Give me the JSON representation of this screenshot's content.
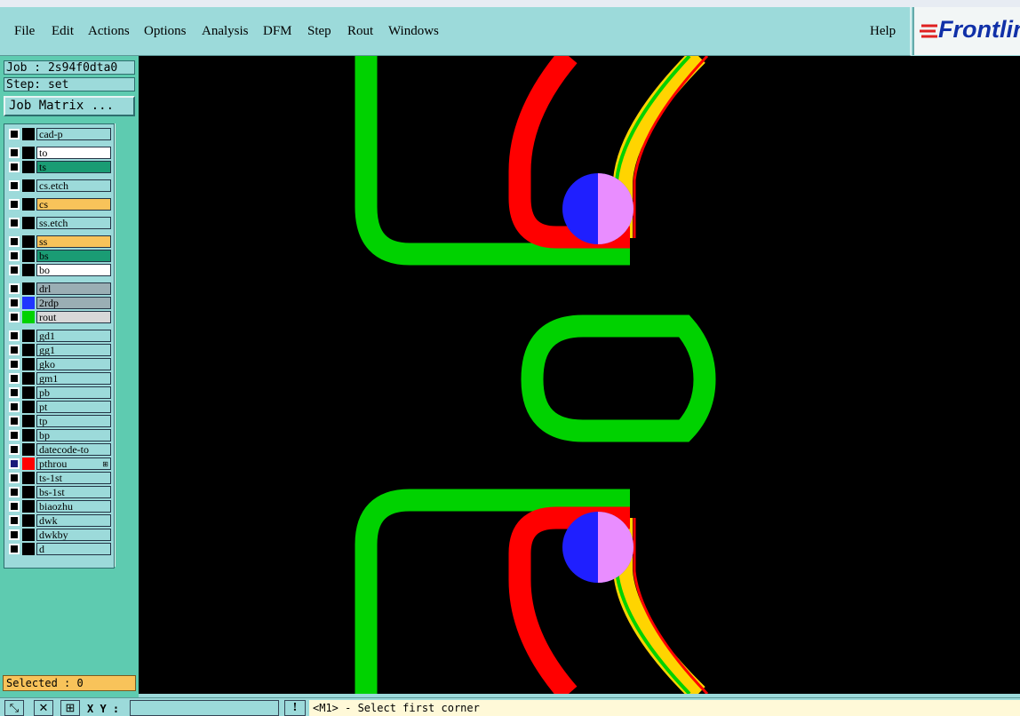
{
  "menu": {
    "items": [
      "File",
      "Edit",
      "Actions",
      "Options",
      "Analysis",
      "DFM",
      "Step",
      "Rout",
      "Windows"
    ],
    "help": "Help"
  },
  "logo": {
    "text": "Frontline"
  },
  "job": {
    "label": "Job : 2s94f0dta0",
    "step": "Step: set"
  },
  "job_matrix_label": "Job Matrix ...",
  "layers": [
    {
      "name": "cad-p",
      "name_bg": "#9cdada",
      "swatch": "#000000",
      "checked": false
    },
    {
      "name": "to",
      "name_bg": "#ffffff",
      "swatch": "#000000",
      "checked": false
    },
    {
      "name": "ts",
      "name_bg": "#1a9c74",
      "swatch": "#000000",
      "checked": false
    },
    {
      "name": "cs.etch",
      "name_bg": "#9cdada",
      "swatch": "#000000",
      "checked": false
    },
    {
      "name": "cs",
      "name_bg": "#f8c35a",
      "swatch": "#000000",
      "checked": false
    },
    {
      "name": "ss.etch",
      "name_bg": "#9cdada",
      "swatch": "#000000",
      "checked": false
    },
    {
      "name": "ss",
      "name_bg": "#f8c35a",
      "swatch": "#000000",
      "checked": false
    },
    {
      "name": "bs",
      "name_bg": "#1a9c74",
      "swatch": "#000000",
      "checked": false
    },
    {
      "name": "bo",
      "name_bg": "#ffffff",
      "swatch": "#000000",
      "checked": false
    },
    {
      "name": "drl",
      "name_bg": "#9aaeb4",
      "swatch": "#000000",
      "checked": false
    },
    {
      "name": "2rdp",
      "name_bg": "#9aaeb4",
      "swatch": "#1f35ff",
      "checked": false
    },
    {
      "name": "rout",
      "name_bg": "#d8d8d8",
      "swatch": "#00d200",
      "checked": false
    },
    {
      "name": "gd1",
      "name_bg": "#9cdada",
      "swatch": "#000000",
      "checked": false
    },
    {
      "name": "gg1",
      "name_bg": "#9cdada",
      "swatch": "#000000",
      "checked": false
    },
    {
      "name": "gko",
      "name_bg": "#9cdada",
      "swatch": "#000000",
      "checked": false
    },
    {
      "name": "gm1",
      "name_bg": "#9cdada",
      "swatch": "#000000",
      "checked": false
    },
    {
      "name": "pb",
      "name_bg": "#9cdada",
      "swatch": "#000000",
      "checked": false
    },
    {
      "name": "pt",
      "name_bg": "#9cdada",
      "swatch": "#000000",
      "checked": false
    },
    {
      "name": "tp",
      "name_bg": "#9cdada",
      "swatch": "#000000",
      "checked": false
    },
    {
      "name": "bp",
      "name_bg": "#9cdada",
      "swatch": "#000000",
      "checked": false
    },
    {
      "name": "datecode-to",
      "name_bg": "#9cdada",
      "swatch": "#000000",
      "checked": false
    },
    {
      "name": "pthrou",
      "name_bg": "#9cdada",
      "swatch": "#ff0000",
      "checked": true
    },
    {
      "name": "ts-1st",
      "name_bg": "#9cdada",
      "swatch": "#000000",
      "checked": false
    },
    {
      "name": "bs-1st",
      "name_bg": "#9cdada",
      "swatch": "#000000",
      "checked": false
    },
    {
      "name": "biaozhu",
      "name_bg": "#9cdada",
      "swatch": "#000000",
      "checked": false
    },
    {
      "name": "dwk",
      "name_bg": "#9cdada",
      "swatch": "#000000",
      "checked": false
    },
    {
      "name": "dwkby",
      "name_bg": "#9cdada",
      "swatch": "#000000",
      "checked": false
    },
    {
      "name": "d",
      "name_bg": "#9cdada",
      "swatch": "#000000",
      "checked": false
    }
  ],
  "selected_label": "Selected : 0",
  "bottom": {
    "xy_label": "X Y :",
    "xy_value": "",
    "alert": "!",
    "status": "<M1> - Select first corner"
  },
  "colors": {
    "rout": "#00d200",
    "pthrou": "#ff0000",
    "yellow": "#ffd400",
    "drill": "#1f1fff",
    "highlight": "#ff99ff",
    "panel": "#9cdada",
    "panel_dark": "#5ecbb0"
  }
}
